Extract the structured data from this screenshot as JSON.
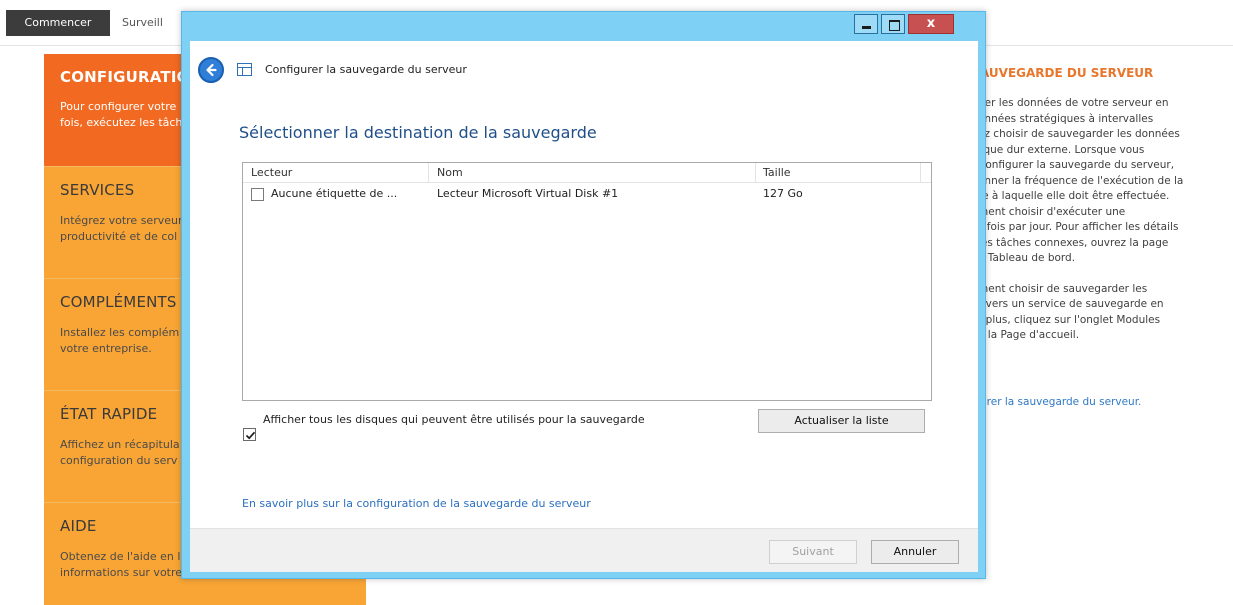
{
  "tabs": {
    "active": "Commencer",
    "inactive": "Surveill"
  },
  "panels": [
    {
      "title": "CONFIGURATION",
      "desc": "Pour configurer votre\nfois, exécutez les tâch"
    },
    {
      "title": "SERVICES",
      "desc": "Intégrez votre serveur\nproductivité et de col"
    },
    {
      "title": "COMPLÉMENTS",
      "desc": "Installez les complém\nvotre entreprise."
    },
    {
      "title": "ÉTAT RAPIDE",
      "desc": "Affichez un récapitula\nconfiguration du serv"
    },
    {
      "title": "AIDE",
      "desc": "Obtenez de l'aide en l\ninformations sur votre"
    }
  ],
  "right_panel": {
    "title": "AUVEGARDE DU SERVEUR",
    "para1": "ger les données de votre serveur en\nonnées stratégiques à intervalles\nez choisir de sauvegarder les données\nsque dur externe. Lorsque vous\nConfigurer la sauvegarde du serveur,\nonner la fréquence de l'exécution de la\nre à laquelle elle doit être effectuée.\nment choisir d'exécuter une\ns fois par jour.  Pour afficher les détails\nles tâches connexes, ouvrez la page\ne Tableau de bord.",
    "para2": "ment choisir de sauvegarder les\nr vers un service de sauvegarde en\nr plus, cliquez sur l'onglet Modules\ne la Page d'accueil.",
    "link": "urer la sauvegarde du serveur."
  },
  "dialog": {
    "window_title": "Configurer la sauvegarde du serveur",
    "heading": "Sélectionner la destination de la sauvegarde",
    "columns": {
      "drive": "Lecteur",
      "name": "Nom",
      "size": "Taille"
    },
    "rows": [
      {
        "drive": "Aucune étiquette de ...",
        "name": "Lecteur Microsoft Virtual Disk #1",
        "size": "127 Go"
      }
    ],
    "show_all_label": "Afficher tous les disques qui peuvent être utilisés pour la sauvegarde",
    "refresh_button": "Actualiser la liste",
    "learn_more_link": "En savoir plus sur la configuration de la sauvegarde du serveur",
    "next_button": "Suivant",
    "cancel_button": "Annuler",
    "close_glyph": "x"
  },
  "icons": {
    "back": "back-arrow-icon",
    "app": "backup-table-icon",
    "minimize": "minimize-icon",
    "maximize": "maximize-icon",
    "close": "close-icon",
    "check": "checkmark-icon"
  },
  "colors": {
    "orange_active": "#f26a21",
    "orange_panel": "#f9a536",
    "dialog_frame": "#7fd0f5",
    "heading_blue": "#1f4f89",
    "link_blue": "#2c6fbf",
    "close_red": "#c75050"
  }
}
